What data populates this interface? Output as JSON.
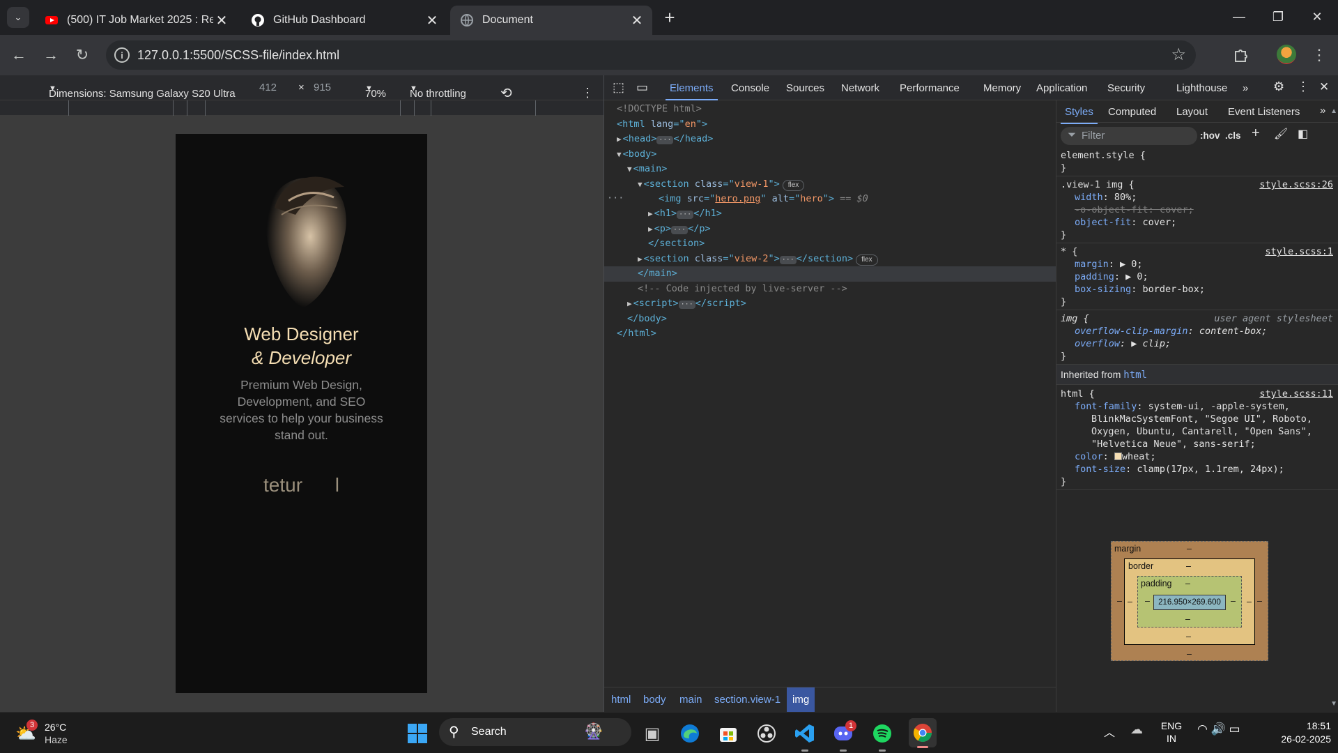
{
  "tabs": [
    {
      "title": "(500) IT Job Market 2025 : Recruit...",
      "icon": "youtube-icon"
    },
    {
      "title": "GitHub Dashboard",
      "icon": "github-icon"
    },
    {
      "title": "Document",
      "icon": "globe-icon"
    }
  ],
  "address": {
    "url": "127.0.0.1:5500/SCSS-file/index.html"
  },
  "device_toolbar": {
    "dimensions": "Dimensions: Samsung Galaxy S20 Ultra",
    "width": "412",
    "times": "×",
    "height": "915",
    "zoom": "70%",
    "throttling": "No throttling"
  },
  "page": {
    "h1_line1": "Web Designer",
    "h1_line2": "& Developer",
    "paragraph": "Premium Web Design, Development, and SEO services to help your business stand out.",
    "typed_text": "tetur      l"
  },
  "devtools": {
    "tabs": [
      "Elements",
      "Console",
      "Sources",
      "Network",
      "Performance",
      "Memory",
      "Application",
      "Security",
      "Lighthouse"
    ],
    "active_tab": "Elements",
    "styles_tabs": [
      "Styles",
      "Computed",
      "Layout",
      "Event Listeners"
    ],
    "filter_placeholder": "Filter",
    "hov": ":hov",
    "cls": ".cls",
    "breadcrumb": [
      "html",
      "body",
      "main",
      "section.view-1",
      "img"
    ],
    "dom": {
      "doctype": "<!DOCTYPE html>",
      "comment": "<!-- Code injected by live-server -->",
      "img_src": "hero.png",
      "img_alt": "hero",
      "sel_marker": "== $0",
      "section1_class": "view-1",
      "section2_class": "view-2",
      "lang": "en",
      "flex_badge": "flex"
    },
    "styles": {
      "element_style": "element.style {",
      "rule1_selector": ".view-1 img {",
      "rule1_source": "style.scss:26",
      "rule1_props": [
        {
          "name": "width",
          "value": "80%;"
        },
        {
          "name": "-o-object-fit",
          "value": "cover;"
        },
        {
          "name": "object-fit",
          "value": "cover;"
        }
      ],
      "rule2_selector": "* {",
      "rule2_source": "style.scss:1",
      "rule2_props": [
        {
          "name": "margin",
          "value": "0;"
        },
        {
          "name": "padding",
          "value": "0;"
        },
        {
          "name": "box-sizing",
          "value": "border-box;"
        }
      ],
      "rule3_selector": "img {",
      "rule3_source": "user agent stylesheet",
      "rule3_props": [
        {
          "name": "overflow-clip-margin",
          "value": "content-box;"
        },
        {
          "name": "overflow",
          "value": "clip;"
        }
      ],
      "inherited_label": "Inherited from",
      "inherited_from": "html",
      "rule4_selector": "html {",
      "rule4_source": "style.scss:11",
      "font_family_name": "font-family",
      "font_family_lines": [
        "system-ui, -apple-system,",
        "BlinkMacSystemFont, \"Segoe UI\", Roboto,",
        "Oxygen, Ubuntu, Cantarell, \"Open Sans\",",
        "\"Helvetica Neue\", sans-serif;"
      ],
      "color_name": "color",
      "color_value": "wheat;",
      "font_size_name": "font-size",
      "font_size_value": "clamp(17px, 1.1rem, 24px);"
    },
    "box_model": {
      "margin_label": "margin",
      "border_label": "border",
      "padding_label": "padding",
      "content": "216.950×269.600",
      "dash": "–"
    }
  },
  "taskbar": {
    "weather_temp": "26°C",
    "weather_desc": "Haze",
    "weather_badge": "3",
    "search_label": "Search",
    "discord_badge": "1",
    "lang_line1": "ENG",
    "lang_line2": "IN",
    "time": "18:51",
    "date": "26-02-2025"
  },
  "colors": {
    "accent": "#7cacf8",
    "wheat": "#f5deb3"
  }
}
